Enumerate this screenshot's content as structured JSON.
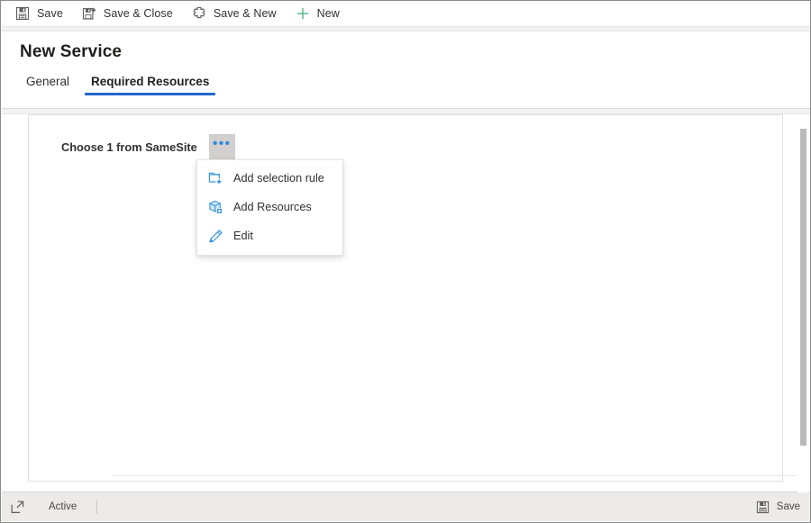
{
  "window": {
    "title": "New Service"
  },
  "commandbar": {
    "buttons": [
      {
        "label": "Save",
        "icon": "save-icon"
      },
      {
        "label": "Save & Close",
        "icon": "save-and-close-icon"
      },
      {
        "label": "Save & New",
        "icon": "save-and-new-icon"
      },
      {
        "label": "New",
        "icon": "plus-icon"
      }
    ]
  },
  "header": {
    "title": "New Service",
    "tabs": [
      {
        "label": "General",
        "active": false
      },
      {
        "label": "Required Resources",
        "active": true
      }
    ]
  },
  "main": {
    "chooser": {
      "label": "Choose 1 from SameSite",
      "menu_button_icon": "ellipsis-icon"
    }
  },
  "context_menu": {
    "items": [
      {
        "label": "Add selection rule",
        "icon": "add-selection-rule-icon"
      },
      {
        "label": "Add Resources",
        "icon": "add-resources-icon"
      },
      {
        "label": "Edit",
        "icon": "pencil-edit-icon"
      }
    ]
  },
  "statusbar": {
    "expand_icon": "popout-expand-icon",
    "state": "Active",
    "save": {
      "label": "Save",
      "icon": "save-icon"
    }
  },
  "colors": {
    "accent_blue": "#2266cc",
    "icon_blue": "#2b88d8",
    "new_green": "#4bb07a",
    "text_primary": "#323130",
    "statusbar_bg": "#edebe9",
    "ellipsis_button_bg": "#d2d0ce",
    "scrollbar_thumb": "#b9b9b9"
  },
  "scroll": {
    "thumb_top_pct": 4,
    "thumb_height_pct": 84
  }
}
